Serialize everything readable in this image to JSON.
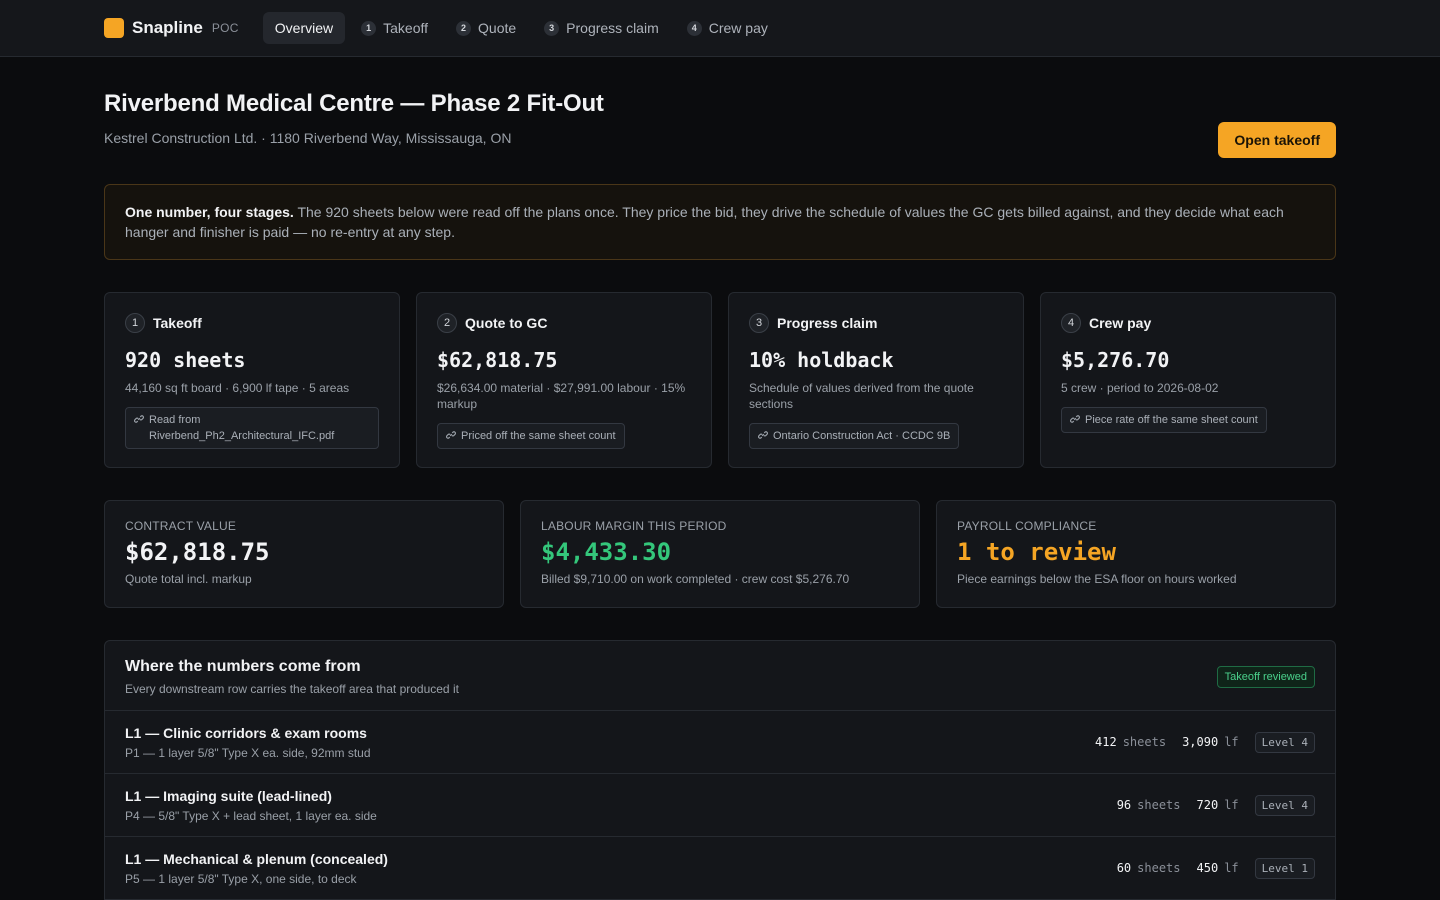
{
  "app": {
    "name": "Snapline",
    "tag": "POC"
  },
  "nav": [
    {
      "label": "Overview",
      "num": ""
    },
    {
      "label": "Takeoff",
      "num": "1"
    },
    {
      "label": "Quote",
      "num": "2"
    },
    {
      "label": "Progress claim",
      "num": "3"
    },
    {
      "label": "Crew pay",
      "num": "4"
    }
  ],
  "header": {
    "title": "Riverbend Medical Centre — Phase 2 Fit-Out",
    "subtitle": "Kestrel Construction Ltd. · 1180 Riverbend Way, Mississauga, ON",
    "action_label": "Open takeoff"
  },
  "callout": {
    "lead": "One number, four stages.",
    "body": " The 920 sheets below were read off the plans once. They price the bid, they drive the schedule of values the GC gets billed against, and they decide what each hanger and finisher is paid — no re-entry at any step."
  },
  "stages": [
    {
      "num": "1",
      "title": "Takeoff",
      "value": "920 sheets",
      "detail": "44,160 sq ft board · 6,900 lf tape · 5 areas",
      "chip": "Read from Riverbend_Ph2_Architectural_IFC.pdf"
    },
    {
      "num": "2",
      "title": "Quote to GC",
      "value": "$62,818.75",
      "detail": "$26,634.00 material · $27,991.00 labour · 15% markup",
      "chip": "Priced off the same sheet count"
    },
    {
      "num": "3",
      "title": "Progress claim",
      "value": "10% holdback",
      "detail": "Schedule of values derived from the quote sections",
      "chip": "Ontario Construction Act · CCDC 9B"
    },
    {
      "num": "4",
      "title": "Crew pay",
      "value": "$5,276.70",
      "detail": "5 crew · period to 2026-08-02",
      "chip": "Piece rate off the same sheet count"
    }
  ],
  "metrics": [
    {
      "label": "CONTRACT VALUE",
      "value": "$62,818.75",
      "note": "Quote total incl. markup",
      "color": "#f2f3f5"
    },
    {
      "label": "LABOUR MARGIN THIS PERIOD",
      "value": "$4,433.30",
      "note": "Billed $9,710.00 on work completed · crew cost $5,276.70",
      "color": "#34c77b"
    },
    {
      "label": "PAYROLL COMPLIANCE",
      "value": "1 to review",
      "note": "Piece earnings below the ESA floor on hours worked",
      "color": "#f5a524"
    }
  ],
  "provenance": {
    "title": "Where the numbers come from",
    "subtitle": "Every downstream row carries the takeoff area that produced it",
    "badge": "Takeoff reviewed",
    "unit_sheets": "sheets",
    "unit_lf": "lf",
    "rows": [
      {
        "name": "L1 — Clinic corridors & exam rooms",
        "spec": "P1 — 1 layer 5/8\" Type X ea. side, 92mm stud",
        "sheets": "412",
        "lf": "3,090",
        "level": "Level 4"
      },
      {
        "name": "L1 — Imaging suite (lead-lined)",
        "spec": "P4 — 5/8\" Type X + lead sheet, 1 layer ea. side",
        "sheets": "96",
        "lf": "720",
        "level": "Level 4"
      },
      {
        "name": "L1 — Mechanical & plenum (concealed)",
        "spec": "P5 — 1 layer 5/8\" Type X, one side, to deck",
        "sheets": "60",
        "lf": "450",
        "level": "Level 1"
      }
    ]
  },
  "colors": {
    "accent": "#f5a524",
    "positive": "#34c77b",
    "background": "#0b0c0e"
  }
}
